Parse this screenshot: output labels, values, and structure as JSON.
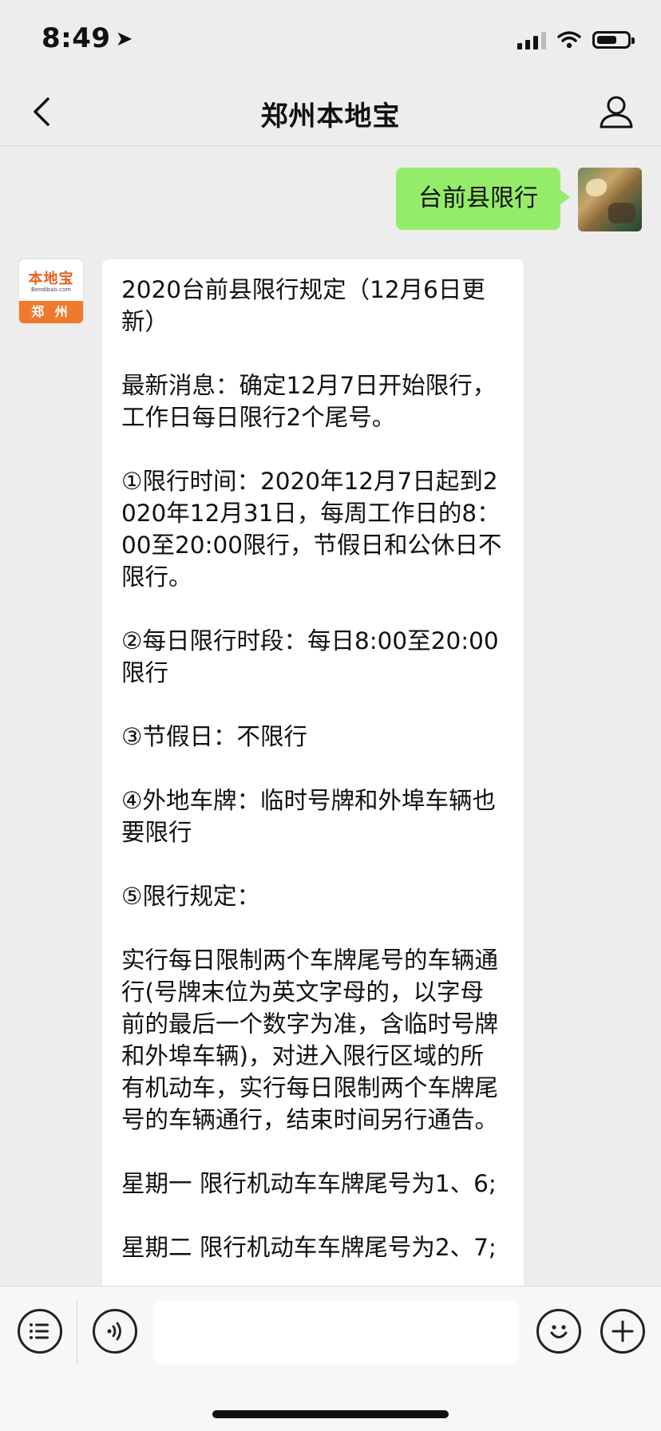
{
  "status": {
    "time": "8:49",
    "signal_level": 0.75,
    "battery_level": 0.55
  },
  "nav": {
    "title": "郑州本地宝",
    "back_icon": "chevron-left-icon",
    "profile_icon": "person-icon"
  },
  "conversation": {
    "outgoing": {
      "text": "台前县限行"
    },
    "bot_avatar": {
      "logo_text": "本地宝",
      "logo_domain": "Bendibao.com",
      "city": "郑 州"
    },
    "incoming": {
      "paragraphs": [
        "2020台前县限行规定（12月6日更新）",
        "最新消息：确定12月7日开始限行，工作日每日限行2个尾号。",
        "①限行时间：2020年12月7日起到2020年12月31日，每周工作日的8：00至20:00限行，节假日和公休日不限行。",
        "②每日限行时段：每日8:00至20:00限行",
        "③节假日：不限行",
        "④外地车牌：临时号牌和外埠车辆也要限行",
        "⑤限行规定：",
        "实行每日限制两个车牌尾号的车辆通行(号牌末位为英文字母的，以字母前的最后一个数字为准，含临时号牌和外埠车辆)，对进入限行区域的所有机动车，实行每日限制两个车牌尾号的车辆通行，结束时间另行通告。",
        "星期一 限行机动车车牌尾号为1、6;",
        "星期二 限行机动车车牌尾号为2、7;"
      ]
    }
  },
  "input_bar": {
    "menu_icon": "list-menu-icon",
    "voice_icon": "voice-icon",
    "emoji_icon": "emoji-icon",
    "add_icon": "plus-icon",
    "text_value": ""
  },
  "colors": {
    "outgoing_bubble": "#95ec69",
    "background": "#ededed",
    "brand_orange": "#f07a2c"
  }
}
